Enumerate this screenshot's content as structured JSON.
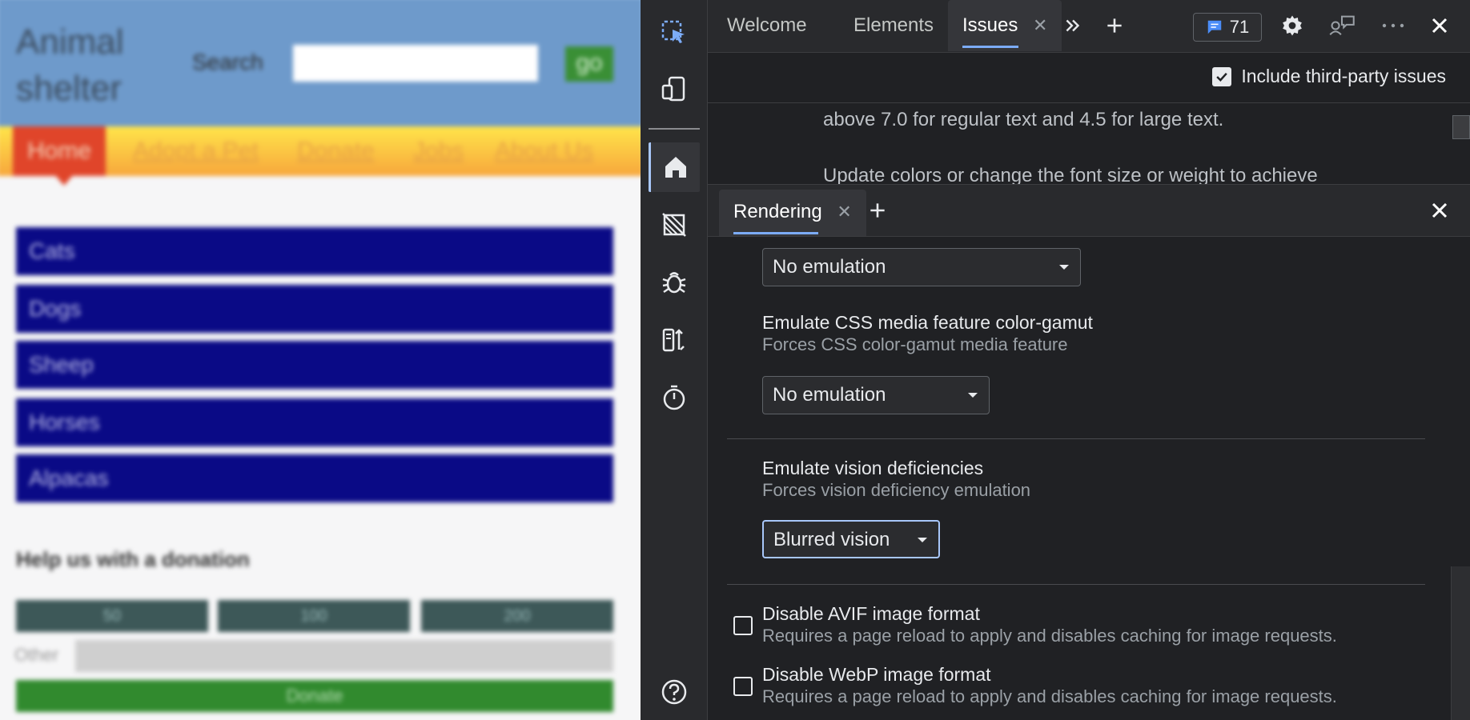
{
  "webpage": {
    "logo": "Animal shelter",
    "search_label": "Search",
    "go_label": "go",
    "nav": [
      "Home",
      "Adopt a Pet",
      "Donate",
      "Jobs",
      "About Us"
    ],
    "animals": [
      "Cats",
      "Dogs",
      "Sheep",
      "Horses",
      "Alpacas"
    ],
    "donation_title": "Help us with a donation",
    "amounts": [
      "50",
      "100",
      "200"
    ],
    "other_label": "Other",
    "donate_button": "Donate"
  },
  "activity_bar": {
    "icons": [
      "inspect-icon",
      "device-emulation-icon",
      "home-icon",
      "no-css-icon",
      "bug-icon",
      "network-icon",
      "performance-icon",
      "help-icon"
    ],
    "selected": "home-icon"
  },
  "top_tabs": {
    "tabs": [
      "Welcome",
      "Elements",
      "Issues"
    ],
    "active": "Issues",
    "issues_count": "71"
  },
  "issues_panel": {
    "include_third_party_label": "Include third-party issues",
    "include_third_party_checked": true,
    "text_line_1": "above 7.0 for regular text and 4.5 for large text.",
    "text_line_2": "Update colors or change the font size or weight to achieve"
  },
  "drawer": {
    "tab_label": "Rendering"
  },
  "rendering": {
    "first_select_value": "No emulation",
    "color_gamut": {
      "title": "Emulate CSS media feature color-gamut",
      "description": "Forces CSS color-gamut media feature",
      "value": "No emulation"
    },
    "vision": {
      "title": "Emulate vision deficiencies",
      "description": "Forces vision deficiency emulation",
      "value": "Blurred vision"
    },
    "avif": {
      "title": "Disable AVIF image format",
      "description": "Requires a page reload to apply and disables caching for image requests.",
      "checked": false
    },
    "webp": {
      "title": "Disable WebP image format",
      "description": "Requires a page reload to apply and disables caching for image requests.",
      "checked": false
    }
  },
  "colors": {
    "accent": "#7cacf8",
    "panel_bg": "#202124",
    "toolbar_bg": "#292a2d"
  }
}
